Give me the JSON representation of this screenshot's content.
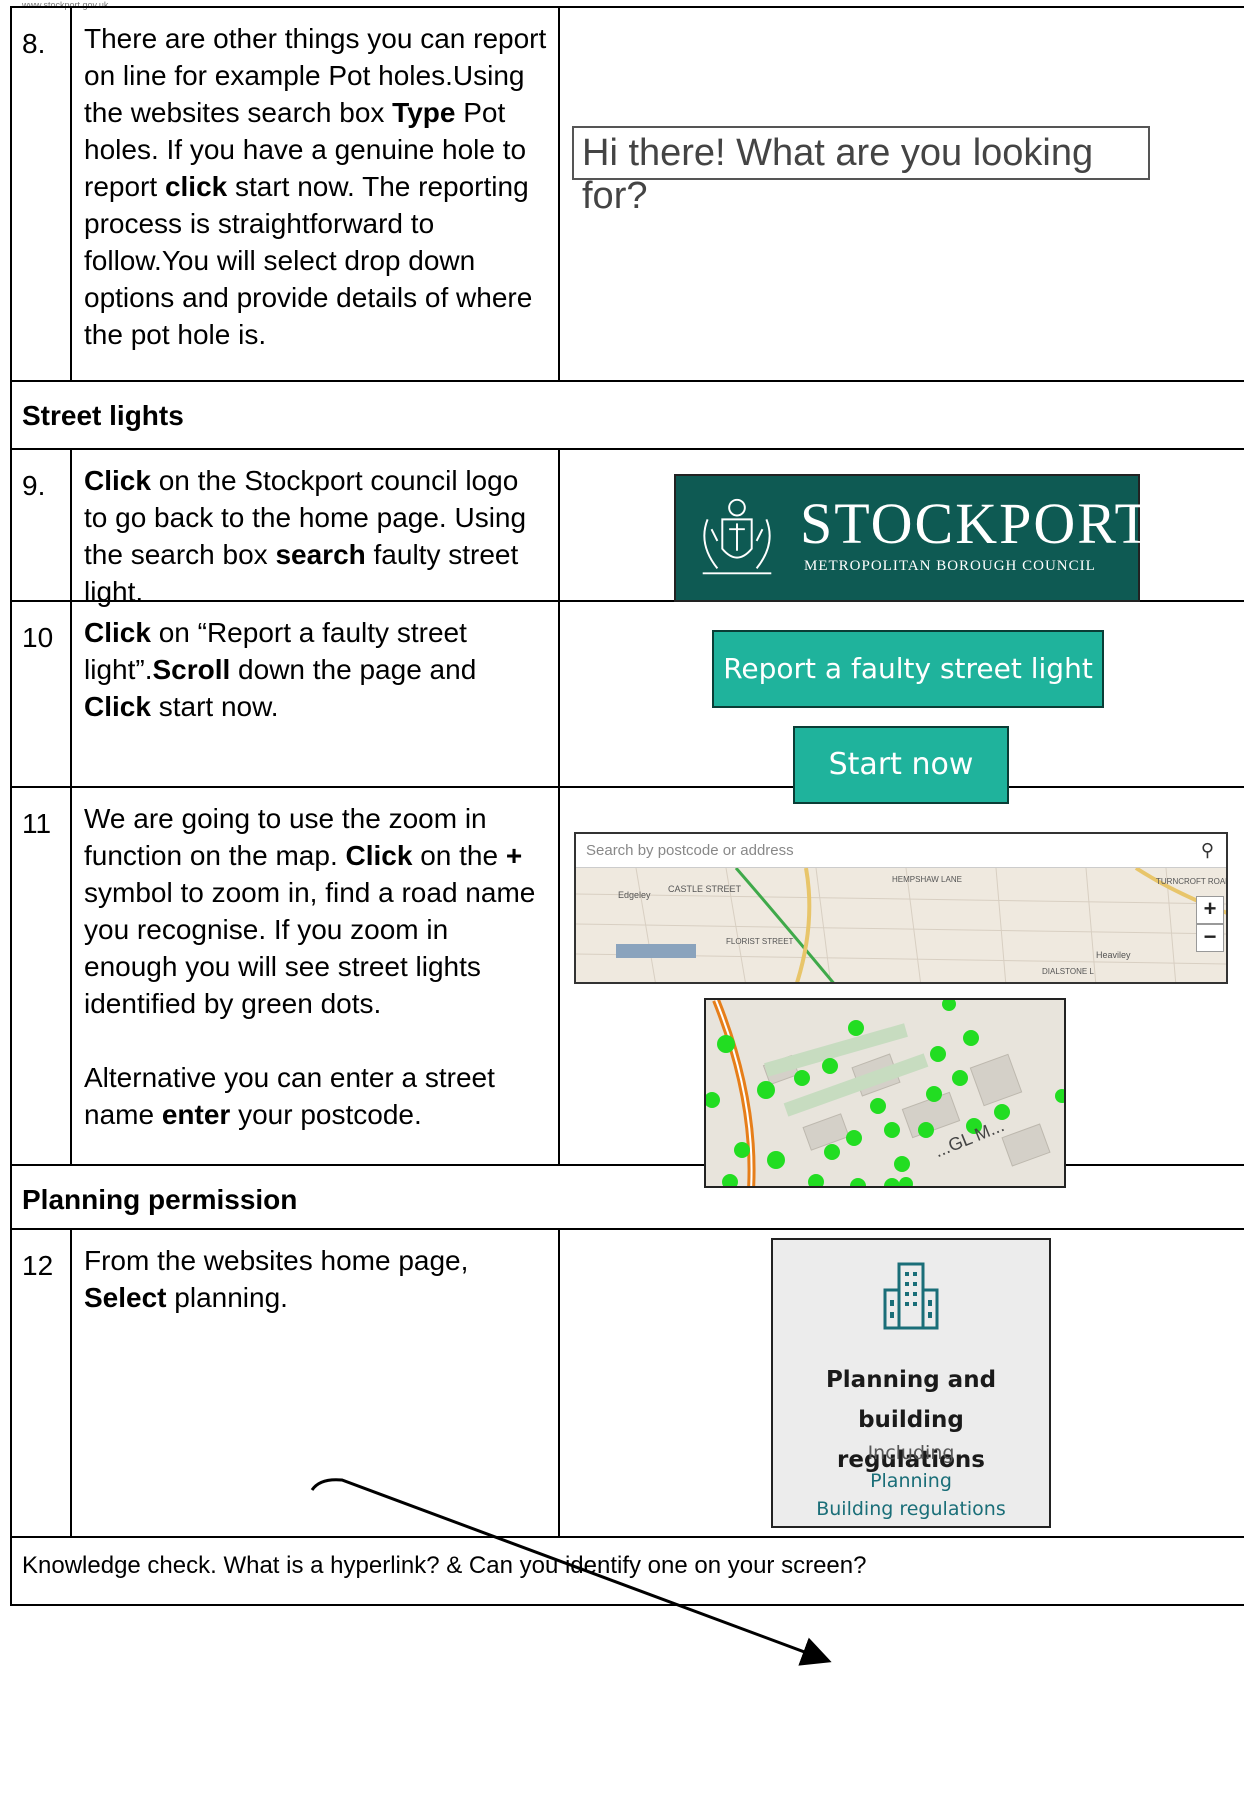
{
  "header": {
    "url": "www.stockport.gov.uk"
  },
  "steps": [
    {
      "number": "8.",
      "parts": [
        {
          "t": "There are other things you can report on line for example Pot holes.Using the websites search box ",
          "b": false
        },
        {
          "t": "Type",
          "b": true
        },
        {
          "t": " Pot holes. If you have a genuine hole to report ",
          "b": false
        },
        {
          "t": "click",
          "b": true
        },
        {
          "t": " start now. The reporting process is straightforward to follow.You will select drop down options and provide details of where the pot hole is.",
          "b": false
        }
      ],
      "search_prompt": "Hi there! What are you looking for?"
    },
    {
      "number": "9.",
      "parts": [
        {
          "t": "Click",
          "b": true
        },
        {
          "t": " on the Stockport council logo to go back to the home page. Using the search box ",
          "b": false
        },
        {
          "t": "search",
          "b": true
        },
        {
          "t": " faulty street light.",
          "b": false
        }
      ],
      "logo_title": "STOCKPORT",
      "logo_subtitle": "METROPOLITAN BOROUGH COUNCIL"
    },
    {
      "number": "10",
      "parts": [
        {
          "t": "Click",
          "b": true
        },
        {
          "t": " on “Report a faulty street light”.",
          "b": false
        },
        {
          "t": "Scroll",
          "b": true
        },
        {
          "t": " down the page and ",
          "b": false
        },
        {
          "t": "Click",
          "b": true
        },
        {
          "t": " start now.",
          "b": false
        }
      ],
      "button1": "Report a faulty street light",
      "button2": "Start now"
    },
    {
      "number": "11",
      "parts": [
        {
          "t": "We are going to use the zoom in function on the map. ",
          "b": false
        },
        {
          "t": "Click",
          "b": true
        },
        {
          "t": " on the ",
          "b": false
        },
        {
          "t": "+",
          "b": true
        },
        {
          "t": " symbol to zoom in, find a road name you recognise. If you zoom in enough you will see street lights identified by green dots.",
          "b": false
        }
      ],
      "parts2": [
        {
          "t": "Alternative you can enter a street name ",
          "b": false
        },
        {
          "t": "enter",
          "b": true
        },
        {
          "t": " your postcode.",
          "b": false
        }
      ],
      "map_search_placeholder": "Search by postcode or address",
      "map_labels": [
        "Edgeley",
        "CASTLE STREET",
        "HEMPSHAW LANE",
        "FLORIST STREET",
        "Heaviley",
        "DIALSTONE L",
        "TURNCROFT ROAD"
      ],
      "map_zoom_label": "...GL M..."
    },
    {
      "number": "12",
      "parts": [
        {
          "t": "From the websites home page, ",
          "b": false
        },
        {
          "t": "Select",
          "b": true
        },
        {
          "t": " planning.",
          "b": false
        }
      ],
      "card_title_line1": "Planning and building",
      "card_title_line2": "regulations",
      "card_including": "Including",
      "card_link1": "Planning",
      "card_link2": "Building regulations"
    }
  ],
  "sections": {
    "street_lights": "Street lights",
    "planning_permission": "Planning permission"
  },
  "footer": "Knowledge check. What is a hyperlink? & Can you identify one on your screen?",
  "colors": {
    "teal": "#1fb39c",
    "logo_green": "#0e5a53",
    "dot_green": "#22dd22",
    "road_orange": "#e67e1a"
  }
}
